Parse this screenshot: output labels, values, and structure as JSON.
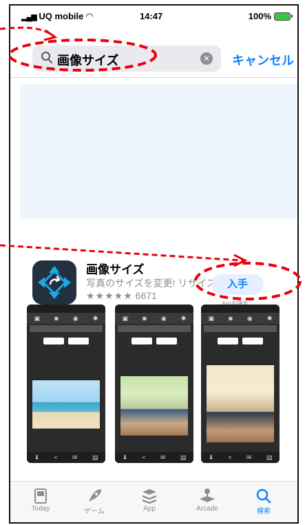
{
  "status": {
    "carrier": "UQ mobile",
    "time": "14:47",
    "battery": "100%"
  },
  "search": {
    "query": "画像サイズ",
    "cancel_label": "キャンセル"
  },
  "app": {
    "name": "画像サイズ",
    "subtitle": "写真のサイズを変更! リサイズ...",
    "rating_stars": "★★★★★",
    "rating_count": "6671",
    "get_label": "入手",
    "iap_label": "App内課金"
  },
  "tabbar": {
    "items": [
      {
        "label": "Today",
        "icon": "today-icon"
      },
      {
        "label": "ゲーム",
        "icon": "rocket-icon"
      },
      {
        "label": "App",
        "icon": "layers-icon"
      },
      {
        "label": "Arcade",
        "icon": "joystick-icon"
      },
      {
        "label": "検索",
        "icon": "search-icon"
      }
    ]
  },
  "colors": {
    "accent": "#0a84ff",
    "annotation": "#e8000b"
  }
}
